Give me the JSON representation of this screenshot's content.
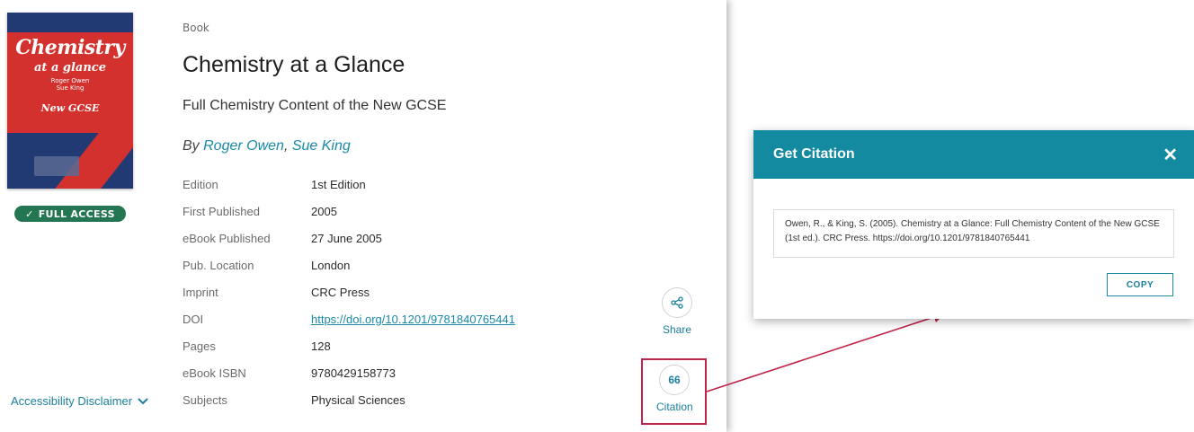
{
  "book": {
    "type_label": "Book",
    "title": "Chemistry at a Glance",
    "subtitle": "Full Chemistry Content of the New GCSE",
    "by_prefix": "By",
    "authors": [
      "Roger Owen",
      "Sue King"
    ],
    "author_separator": ", ",
    "cover": {
      "title_line1": "Chemistry",
      "title_line2": "at a glance",
      "authors_line1": "Roger Owen",
      "authors_line2": "Sue King",
      "edition_line": "New GCSE",
      "colors": {
        "background": "#223a74",
        "band": "#d3312d"
      }
    },
    "access_badge": "FULL ACCESS"
  },
  "metadata": [
    {
      "label": "Edition",
      "value": "1st Edition"
    },
    {
      "label": "First Published",
      "value": "2005"
    },
    {
      "label": "eBook Published",
      "value": "27 June 2005"
    },
    {
      "label": "Pub. Location",
      "value": "London"
    },
    {
      "label": "Imprint",
      "value": "CRC Press"
    },
    {
      "label": "DOI",
      "value": "https://doi.org/10.1201/9781840765441",
      "is_link": true
    },
    {
      "label": "Pages",
      "value": "128"
    },
    {
      "label": "eBook ISBN",
      "value": "9780429158773"
    },
    {
      "label": "Subjects",
      "value": "Physical Sciences"
    }
  ],
  "accessibility_disclaimer": "Accessibility Disclaimer",
  "actions": {
    "share_label": "Share",
    "share_icon": "share-icon",
    "citation_label": "Citation",
    "citation_icon_glyph": "66"
  },
  "modal": {
    "title": "Get Citation",
    "close_glyph": "✕",
    "citation_text": "Owen, R., & King, S. (2005). Chemistry at a Glance: Full Chemistry Content of the New GCSE (1st ed.). CRC Press. https://doi.org/10.1201/9781840765441",
    "copy_label": "COPY"
  },
  "colors": {
    "accent": "#138aa0",
    "link": "#1a8aa6",
    "badge_green": "#247551",
    "highlight": "#c0234a"
  }
}
